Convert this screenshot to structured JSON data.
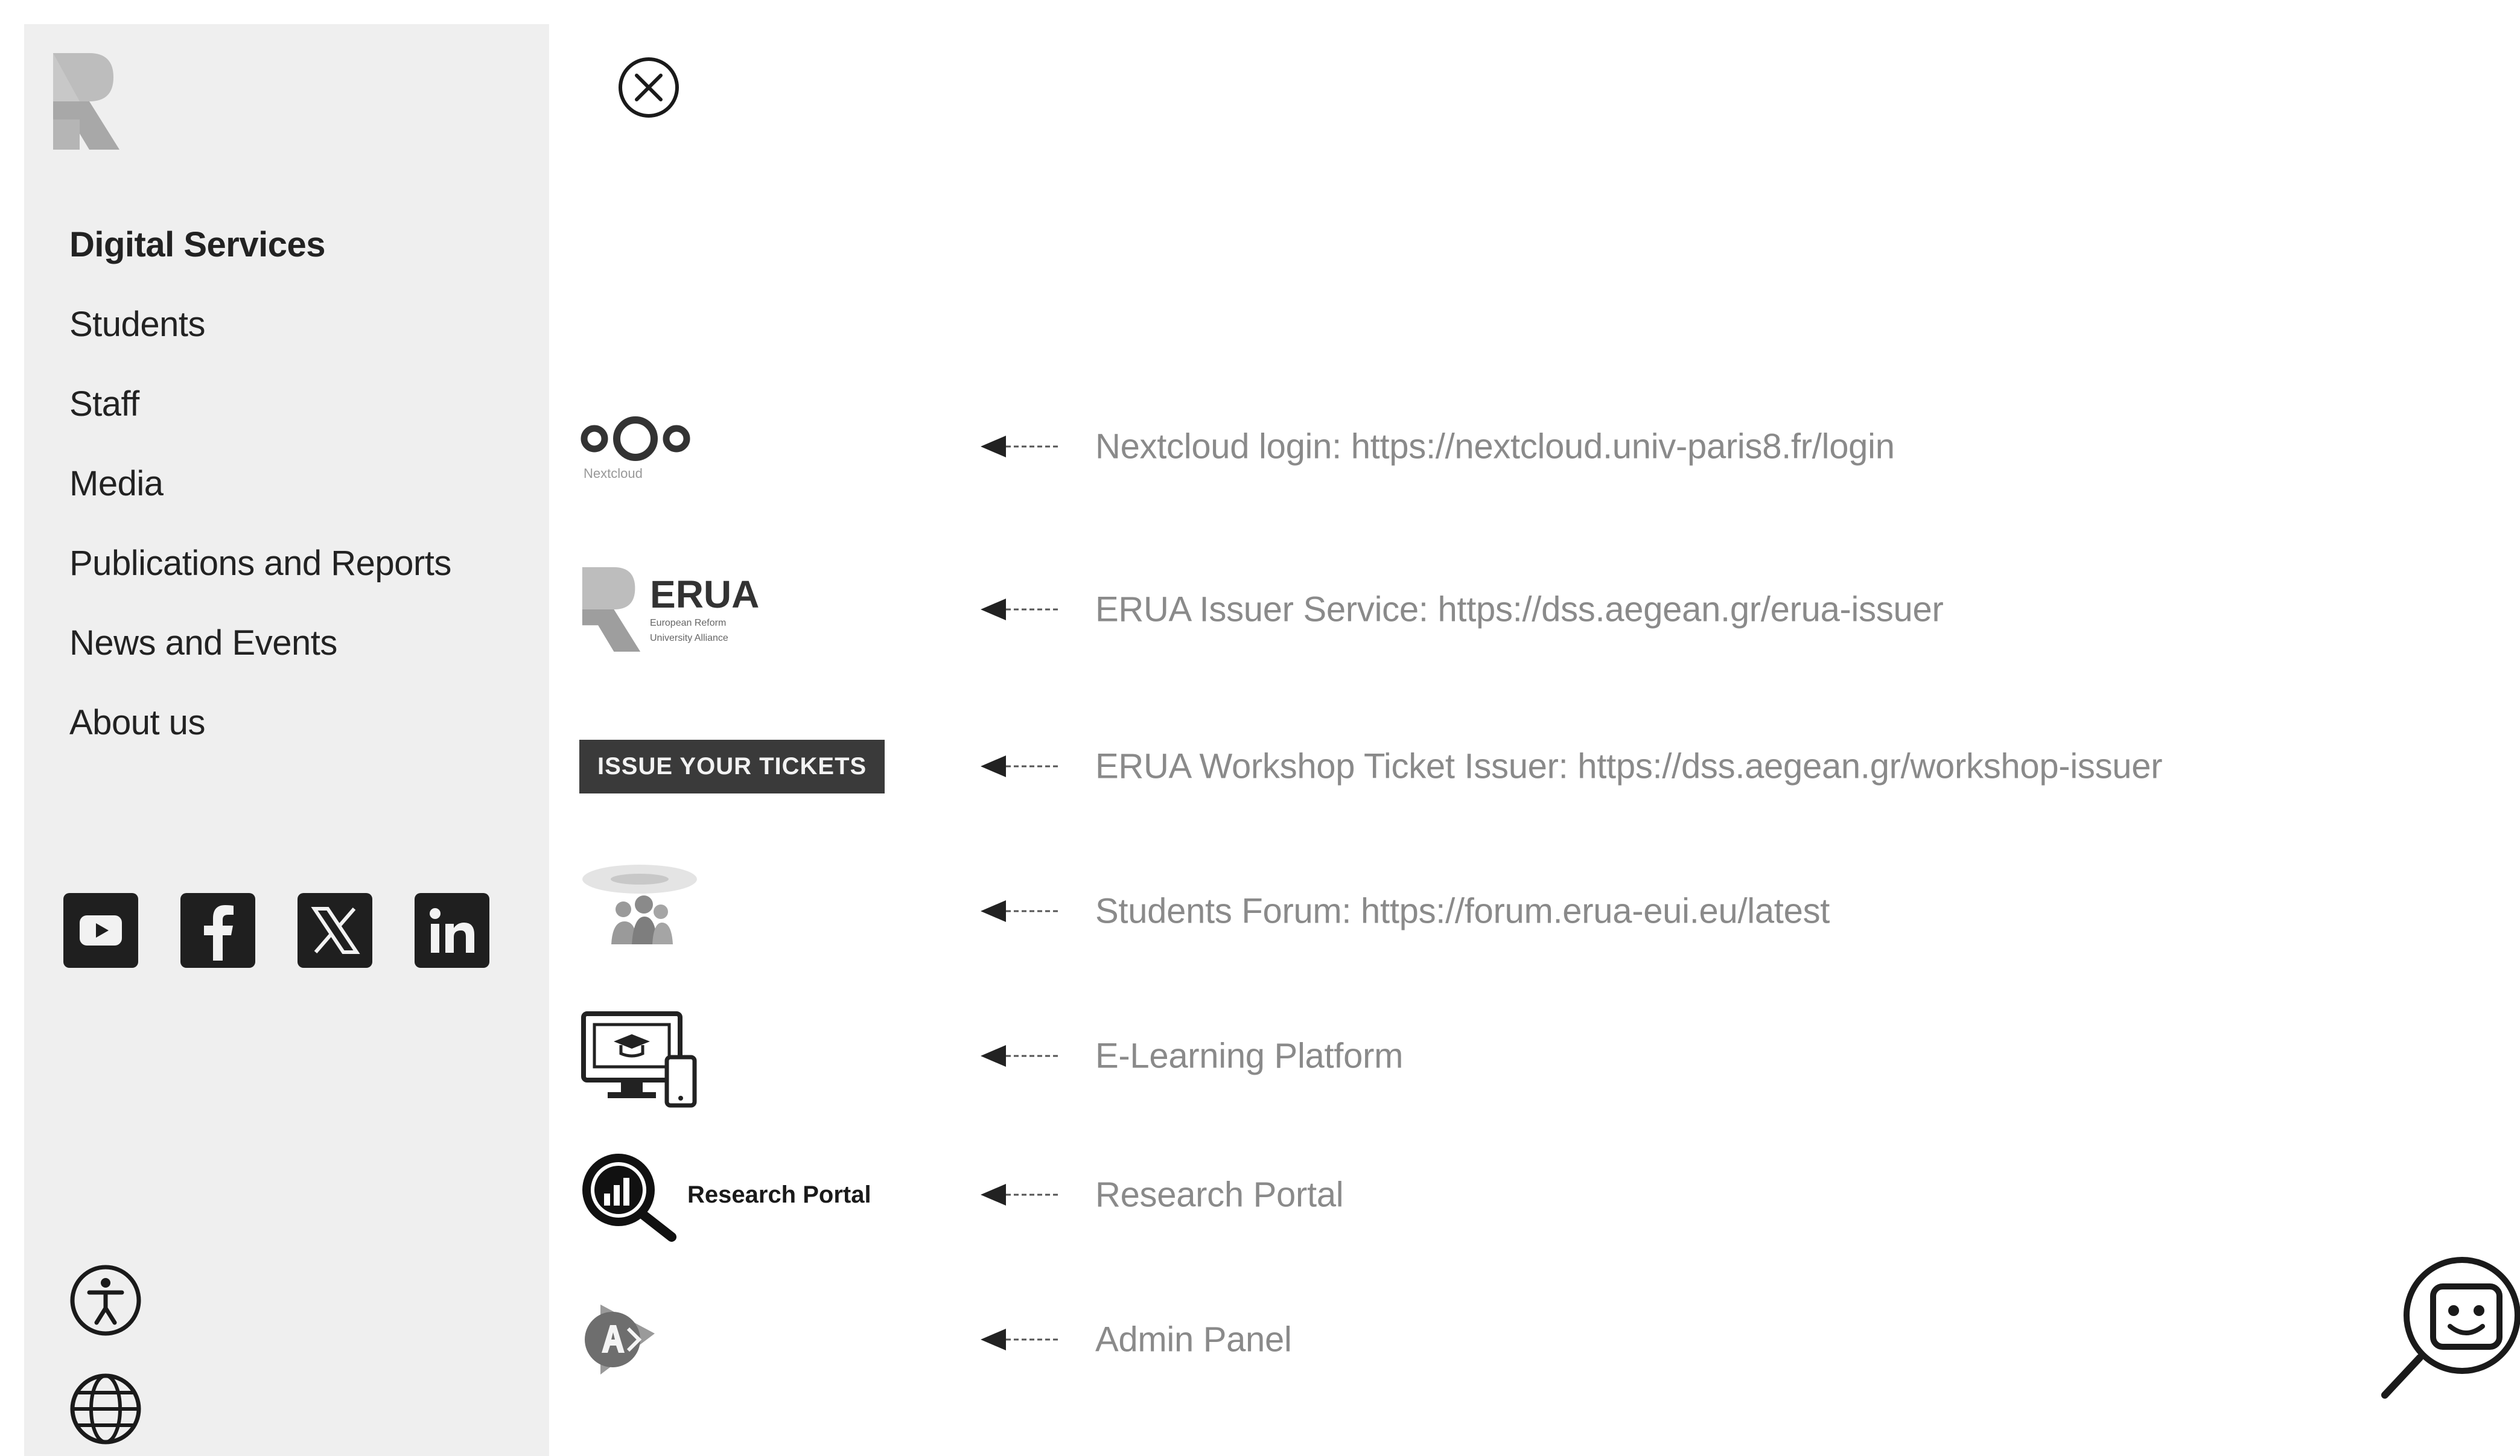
{
  "sidebar": {
    "nav": [
      {
        "label": "Digital Services",
        "active": true
      },
      {
        "label": "Students"
      },
      {
        "label": "Staff"
      },
      {
        "label": "Media"
      },
      {
        "label": "Publications and Reports"
      },
      {
        "label": "News and Events"
      },
      {
        "label": "About us"
      }
    ],
    "social": [
      "youtube-icon",
      "facebook-icon",
      "x-icon",
      "linkedin-icon"
    ],
    "utility": [
      "accessibility-icon",
      "globe-icon"
    ]
  },
  "services": [
    {
      "logo": "nextcloud",
      "logo_caption": "Nextcloud",
      "label": "Nextcloud login: https://nextcloud.univ-paris8.fr/login"
    },
    {
      "logo": "erua",
      "logo_title": "ERUA",
      "logo_sub1": "European Reform",
      "logo_sub2": "University Alliance",
      "label": "ERUA Issuer Service: https://dss.aegean.gr/erua-issuer"
    },
    {
      "logo": "tickets",
      "logo_text": "ISSUE YOUR TICKETS",
      "label": "ERUA Workshop Ticket Issuer: https://dss.aegean.gr/workshop-issuer"
    },
    {
      "logo": "forum",
      "label": "Students Forum: https://forum.erua-eui.eu/latest"
    },
    {
      "logo": "elearning",
      "label": "E-Learning Platform"
    },
    {
      "logo": "research",
      "logo_text": "Research Portal",
      "label": "Research Portal"
    },
    {
      "logo": "admin",
      "label": "Admin Panel"
    }
  ],
  "colors": {
    "sidebar_bg": "#efefef",
    "label_text": "#8a8a8a",
    "dark": "#1f1f1f"
  }
}
